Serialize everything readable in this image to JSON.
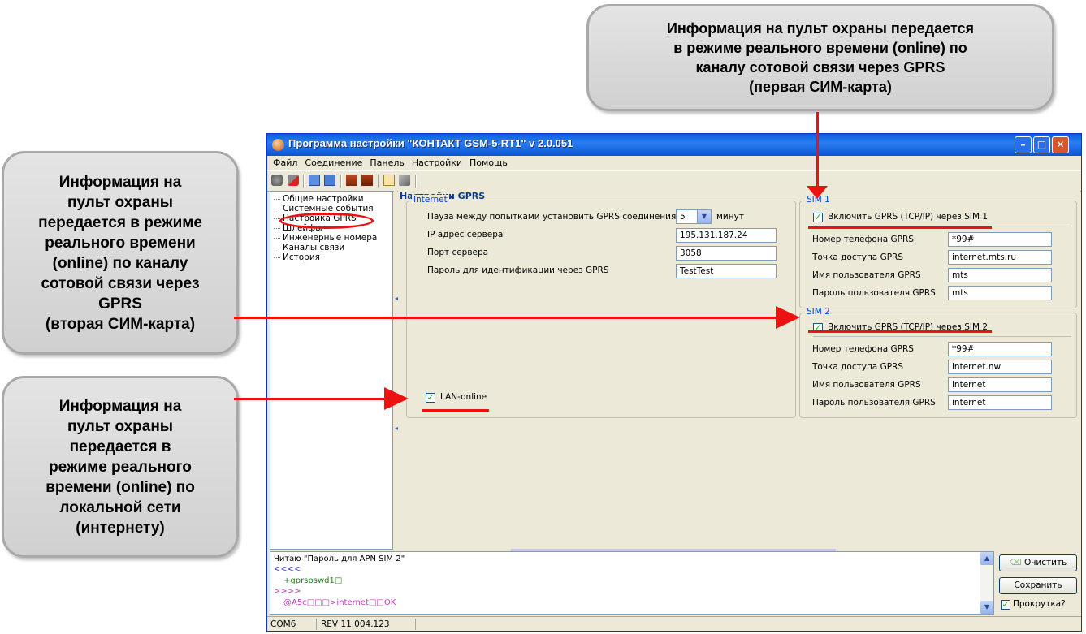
{
  "callouts": {
    "top": "Информация на пульт охраны передается\nв режиме реального времени (online) по\nканалу сотовой связи через GPRS\n(первая СИМ-карта)",
    "left1": "Информация на\nпульт охраны\nпередается в режиме\nреального времени\n(online) по каналу\nсотовой связи через\nGPRS\n(вторая СИМ-карта)",
    "left2": "Информация на\nпульт охраны\nпередается в\nрежиме реального\nвремени (online) по\nлокальной сети\n(интернету)"
  },
  "window": {
    "title": "Программа настройки \"КОНТАКТ GSM-5-RT1\" v 2.0.051",
    "controls": {
      "minimize": "–",
      "maximize": "□",
      "close": "✕"
    }
  },
  "menu": [
    "Файл",
    "Соединение",
    "Панель",
    "Настройки",
    "Помощь"
  ],
  "toolbar_icons": [
    "connect-icon",
    "disconnect-icon",
    "read-icon",
    "write-icon",
    "upload-icon",
    "download-icon",
    "notepad-icon",
    "settings-icon"
  ],
  "tree": [
    "Общие настройки",
    "Системные события",
    "Настройка GPRS",
    "Шлейфы",
    "Инженерные номера",
    "Каналы связи",
    "История"
  ],
  "panel": {
    "title": "Настройки GPRS",
    "internet": {
      "legend": "Internet",
      "pause_label": "Пауза между попытками установить GPRS соединения",
      "pause_value": "5",
      "pause_unit": "минут",
      "ip_label": "IP адрес сервера",
      "ip_value": "195.131.187.24",
      "port_label": "Порт сервера",
      "port_value": "3058",
      "password_label": "Пароль для идентификации через GPRS",
      "password_value": "TestTest",
      "lan_label": "LAN-online",
      "lan_checked": true
    },
    "sim1": {
      "legend": "SIM 1",
      "enable_label": "Включить GPRS (TCP/IP) через SIM 1",
      "enabled": true,
      "phone_label": "Номер телефона GPRS",
      "phone_value": "*99#",
      "apn_label": "Точка доступа GPRS",
      "apn_value": "internet.mts.ru",
      "user_label": "Имя пользователя GPRS",
      "user_value": "mts",
      "pass_label": "Пароль пользователя GPRS",
      "pass_value": "mts"
    },
    "sim2": {
      "legend": "SIM 2",
      "enable_label": "Включить GPRS (TCP/IP) через SIM 2",
      "enabled": true,
      "phone_label": "Номер телефона GPRS",
      "phone_value": "*99#",
      "apn_label": "Точка доступа GPRS",
      "apn_value": "internet.nw",
      "user_label": "Имя пользователя GPRS",
      "user_value": "internet",
      "pass_label": "Пароль пользователя GPRS",
      "pass_value": "internet"
    }
  },
  "log": {
    "lines": [
      "Читаю \"Пароль для APN SIM 2\"",
      "<<<<",
      "+gprspswd1□",
      ">>>>",
      "@A5c□□□>internet□□OK"
    ],
    "colors": [
      "#000000",
      "#3a3ad0",
      "#208020",
      "#c040c0",
      "#c040c0"
    ]
  },
  "buttons": {
    "clear": "Очистить",
    "save": "Сохранить",
    "scroll": "Прокрутка?",
    "scroll_checked": true
  },
  "status": {
    "port": "COM6",
    "rev": "REV 11.004.123"
  },
  "accent": {
    "red": "#ee1111",
    "title_blue": "#0a5fd8",
    "legend_blue": "#0046d5"
  }
}
